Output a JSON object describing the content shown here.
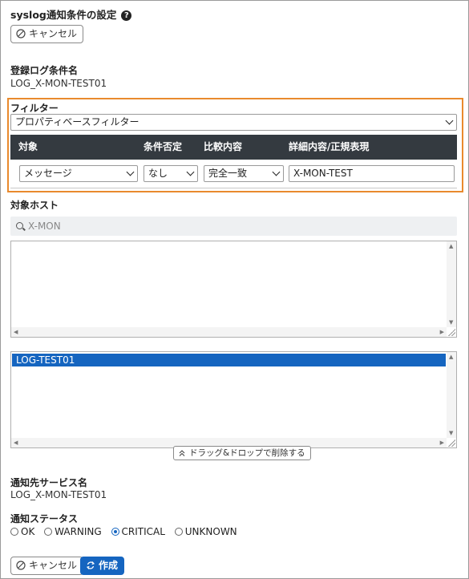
{
  "header": {
    "title": "syslog通知条件の設定",
    "help_icon": "?"
  },
  "buttons": {
    "cancel_label": "キャンセル",
    "create_label": "作成"
  },
  "log_condition": {
    "label": "登録ログ条件名",
    "value": "LOG_X-MON-TEST01"
  },
  "filter": {
    "label": "フィルター",
    "type_selected": "プロパティベースフィルター",
    "columns": [
      "対象",
      "条件否定",
      "比較内容",
      "詳細内容/正規表現"
    ],
    "row": {
      "target": "メッセージ",
      "negate": "なし",
      "compare": "完全一致",
      "detail": "X-MON-TEST"
    }
  },
  "target_host": {
    "label": "対象ホスト",
    "search_text": "X-MON",
    "selected_items": [
      "LOG-TEST01"
    ],
    "drag_drop_label": "ドラッグ&ドロップで削除する"
  },
  "notify_service": {
    "label": "通知先サービス名",
    "value": "LOG_X-MON-TEST01"
  },
  "notify_status": {
    "label": "通知ステータス",
    "options": [
      "OK",
      "WARNING",
      "CRITICAL",
      "UNKNOWN"
    ],
    "selected": "CRITICAL"
  },
  "colors": {
    "accent": "#1565c0",
    "filter_border": "#e98a2d",
    "table_header": "#343a40"
  }
}
